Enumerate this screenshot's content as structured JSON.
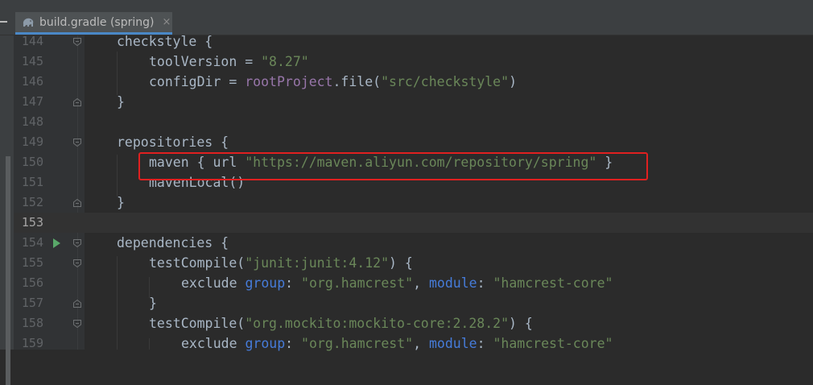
{
  "tab": {
    "title": "build.gradle (spring)",
    "close": "×"
  },
  "lines": [
    {
      "num": "144",
      "indent": 1,
      "parts": [
        [
          "plain",
          "checkstyle {"
        ]
      ],
      "fold": "open"
    },
    {
      "num": "145",
      "indent": 2,
      "parts": [
        [
          "plain",
          "toolVersion = "
        ],
        [
          "str",
          "\"8.27\""
        ]
      ]
    },
    {
      "num": "146",
      "indent": 2,
      "parts": [
        [
          "plain",
          "configDir = "
        ],
        [
          "prop",
          "rootProject"
        ],
        [
          "plain",
          ".file("
        ],
        [
          "str",
          "\"src/checkstyle\""
        ],
        [
          "plain",
          ")"
        ]
      ]
    },
    {
      "num": "147",
      "indent": 1,
      "parts": [
        [
          "plain",
          "}"
        ]
      ],
      "fold": "close"
    },
    {
      "num": "148",
      "indent": 0,
      "parts": []
    },
    {
      "num": "149",
      "indent": 1,
      "parts": [
        [
          "plain",
          "repositories {"
        ]
      ],
      "fold": "open"
    },
    {
      "num": "150",
      "indent": 2,
      "parts": [
        [
          "plain",
          "maven { url "
        ],
        [
          "str",
          "\"https://maven.aliyun.com/repository/spring\""
        ],
        [
          "plain",
          " }"
        ]
      ]
    },
    {
      "num": "151",
      "indent": 2,
      "parts": [
        [
          "plain",
          "mavenLocal()"
        ]
      ]
    },
    {
      "num": "152",
      "indent": 1,
      "parts": [
        [
          "plain",
          "}"
        ]
      ],
      "fold": "close"
    },
    {
      "num": "153",
      "indent": 0,
      "parts": [],
      "current": true
    },
    {
      "num": "154",
      "indent": 1,
      "parts": [
        [
          "plain",
          "dependencies {"
        ]
      ],
      "fold": "open",
      "run": true
    },
    {
      "num": "155",
      "indent": 2,
      "parts": [
        [
          "plain",
          "testCompile("
        ],
        [
          "str",
          "\"junit:junit:4.12\""
        ],
        [
          "plain",
          ") {"
        ]
      ],
      "fold": "open"
    },
    {
      "num": "156",
      "indent": 3,
      "parts": [
        [
          "plain",
          "exclude "
        ],
        [
          "named",
          "group"
        ],
        [
          "plain",
          ": "
        ],
        [
          "str",
          "\"org.hamcrest\""
        ],
        [
          "plain",
          ", "
        ],
        [
          "named",
          "module"
        ],
        [
          "plain",
          ": "
        ],
        [
          "str",
          "\"hamcrest-core\""
        ]
      ]
    },
    {
      "num": "157",
      "indent": 2,
      "parts": [
        [
          "plain",
          "}"
        ]
      ],
      "fold": "close"
    },
    {
      "num": "158",
      "indent": 2,
      "parts": [
        [
          "plain",
          "testCompile("
        ],
        [
          "str",
          "\"org.mockito:mockito-core:2.28.2\""
        ],
        [
          "plain",
          ") {"
        ]
      ],
      "fold": "open"
    },
    {
      "num": "159",
      "indent": 3,
      "parts": [
        [
          "plain",
          "exclude "
        ],
        [
          "named",
          "group"
        ],
        [
          "plain",
          ": "
        ],
        [
          "str",
          "\"org.hamcrest\""
        ],
        [
          "plain",
          ", "
        ],
        [
          "named",
          "module"
        ],
        [
          "plain",
          ": "
        ],
        [
          "str",
          "\"hamcrest-core\""
        ]
      ]
    }
  ]
}
